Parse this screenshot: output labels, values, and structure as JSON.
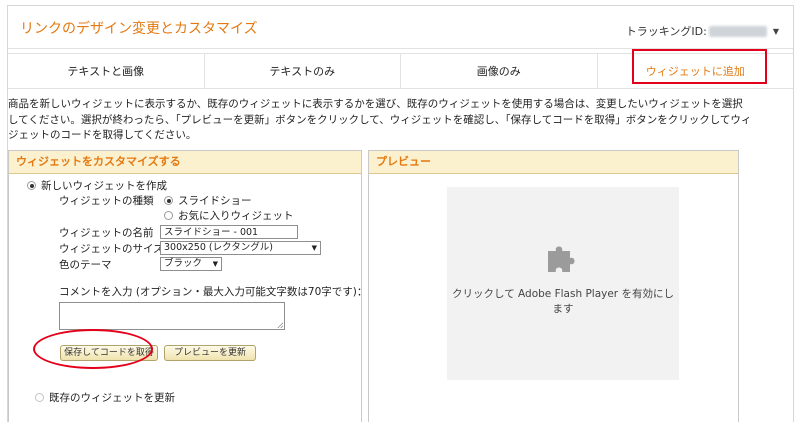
{
  "header": {
    "title": "リンクのデザイン変更とカスタマイズ",
    "tracking_label": "トラッキングID:"
  },
  "tabs": [
    {
      "label": "テキストと画像"
    },
    {
      "label": "テキストのみ"
    },
    {
      "label": "画像のみ"
    },
    {
      "label": "ウィジェットに追加"
    }
  ],
  "description": "商品を新しいウィジェットに表示するか、既存のウィジェットに表示するかを選び、既存のウィジェットを使用する場合は、変更したいウィジェットを選択してください。選択が終わったら、「プレビューを更新」ボタンをクリックして、ウィジェットを確認し、「保存してコードを取得」ボタンをクリックしてウィジェットのコードを取得してください。",
  "customize": {
    "title": "ウィジェットをカスタマイズする",
    "new_widget_label": "新しいウィジェットを作成",
    "type_label": "ウィジェットの種類",
    "type_options": [
      "スライドショー",
      "お気に入りウィジェット"
    ],
    "name_label": "ウィジェットの名前",
    "name_value": "スライドショー - 001",
    "size_label": "ウィジェットのサイズ",
    "size_value": "300x250 (レクタングル)",
    "theme_label": "色のテーマ",
    "theme_value": "ブラック",
    "comment_label": "コメントを入力 (オプション・最大入力可能文字数は70字です)：",
    "save_button": "保存してコードを取得",
    "preview_button": "プレビューを更新",
    "existing_widget_label": "既存のウィジェットを更新"
  },
  "preview": {
    "title": "プレビュー",
    "message": "クリックして Adobe Flash Player を有効にします"
  },
  "colors": {
    "accent": "#e47911",
    "highlight_red": "#e4001b",
    "panel_header": "#fbf1cf"
  }
}
